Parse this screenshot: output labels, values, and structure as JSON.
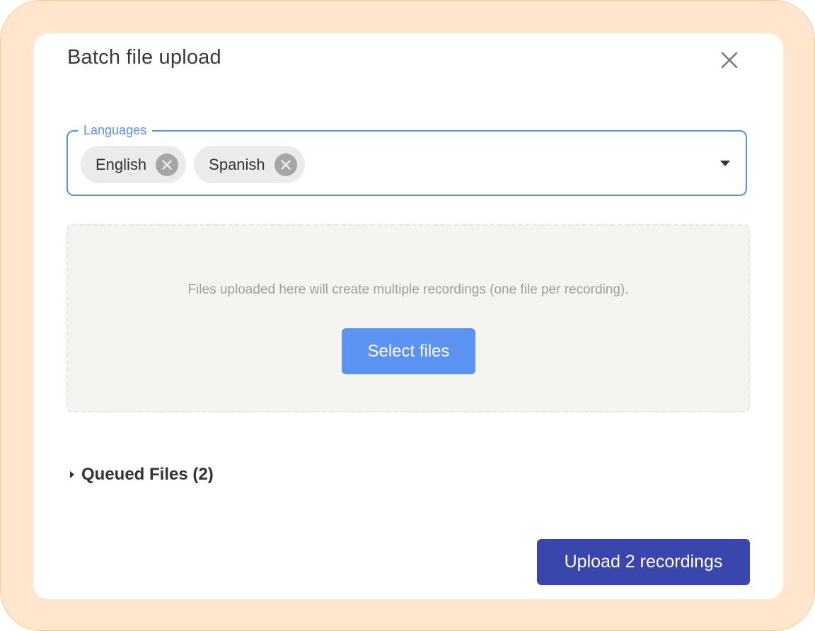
{
  "dialog": {
    "title": "Batch file upload",
    "close_icon": "close-icon"
  },
  "languages": {
    "label": "Languages",
    "selected": [
      {
        "label": "English",
        "remove_icon": "remove-chip-icon"
      },
      {
        "label": "Spanish",
        "remove_icon": "remove-chip-icon"
      }
    ],
    "dropdown_icon": "dropdown-arrow-icon"
  },
  "dropzone": {
    "hint": "Files uploaded here will create multiple recordings (one file per recording).",
    "select_label": "Select files"
  },
  "queued": {
    "label": "Queued Files (2)",
    "icon": "caret-right-icon"
  },
  "footer": {
    "upload_label": "Upload 2 recordings"
  },
  "colors": {
    "backdrop": "#ffe6cc",
    "focus_outline": "#5d8fe4",
    "select_button": "#5b93f2",
    "upload_button": "#3a46ab"
  }
}
